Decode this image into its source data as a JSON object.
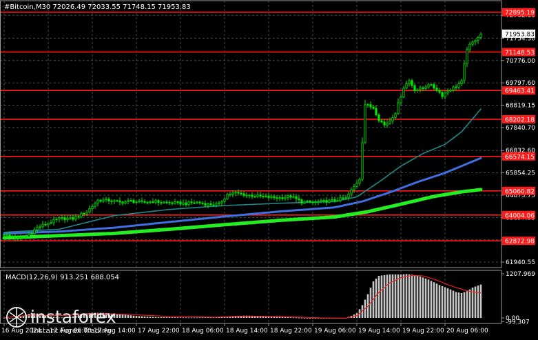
{
  "header": {
    "title": "#Bitcoin,M30  72026.49 72033.55 71748.15 71953.83"
  },
  "macd_header": "MACD(12,26,9) 913.251 688.054",
  "watermark": {
    "brand": "instaforex",
    "tagline": "Instant Forex Trading"
  },
  "colors": {
    "background": "#000000",
    "grid": "#4a4a4a",
    "candle": "#00e800",
    "level_line": "#ff1a1a",
    "ma_fast": "#1e8a8a",
    "ma_mid": "#3f6fe0",
    "ma_slow": "#22ee22",
    "macd_hist": "#c8c8c8",
    "macd_signal": "#ff2020",
    "label_bg": "#ff1a1a",
    "current_price_bg": "#ffffff"
  },
  "chart_data": [
    {
      "type": "candlestick",
      "symbol": "#Bitcoin",
      "timeframe": "M30",
      "ohlc_last": {
        "open": 72026.49,
        "high": 72033.55,
        "low": 71748.15,
        "close": 71953.83
      },
      "current_price": "71953.83",
      "ylim": [
        61700,
        73400
      ],
      "y_ticks": [
        "72762.60",
        "71754.30",
        "70776.00",
        "69797.60",
        "68819.15",
        "67840.70",
        "66832.60",
        "65854.25",
        "64875.75",
        "63897.35",
        "62919.00",
        "61940.55"
      ],
      "x_ticks": [
        "16 Aug 2024",
        "17 Aug 06:00",
        "17 Aug 14:00",
        "17 Aug 22:00",
        "18 Aug 06:00",
        "18 Aug 14:00",
        "18 Aug 22:00",
        "19 Aug 06:00",
        "19 Aug 14:00",
        "19 Aug 22:00",
        "20 Aug 06:00"
      ],
      "x_tick_bars": [
        0,
        16,
        32,
        48,
        64,
        80,
        96,
        112,
        128,
        144,
        160
      ],
      "levels": [
        {
          "label": "72895.19",
          "value": 72895.19
        },
        {
          "label": "71148.53",
          "value": 71148.53
        },
        {
          "label": "69463.41",
          "value": 69463.41
        },
        {
          "label": "68202.18",
          "value": 68202.18
        },
        {
          "label": "66574.15",
          "value": 66574.15
        },
        {
          "label": "65060.82",
          "value": 65060.82
        },
        {
          "label": "64004.06",
          "value": 64004.06
        },
        {
          "label": "62872.98",
          "value": 62872.98
        }
      ],
      "close_anchors": [
        [
          0,
          63150
        ],
        [
          5,
          62980
        ],
        [
          8,
          63050
        ],
        [
          12,
          63450
        ],
        [
          16,
          63650
        ],
        [
          20,
          63850
        ],
        [
          25,
          63850
        ],
        [
          30,
          64150
        ],
        [
          34,
          64650
        ],
        [
          38,
          64650
        ],
        [
          42,
          64560
        ],
        [
          46,
          64620
        ],
        [
          50,
          64550
        ],
        [
          54,
          64600
        ],
        [
          58,
          64560
        ],
        [
          62,
          64530
        ],
        [
          66,
          64510
        ],
        [
          70,
          64560
        ],
        [
          74,
          64470
        ],
        [
          78,
          64480
        ],
        [
          81,
          64900
        ],
        [
          84,
          64970
        ],
        [
          88,
          64880
        ],
        [
          92,
          64830
        ],
        [
          96,
          64780
        ],
        [
          100,
          64760
        ],
        [
          104,
          64820
        ],
        [
          108,
          64580
        ],
        [
          112,
          64560
        ],
        [
          116,
          64600
        ],
        [
          120,
          64650
        ],
        [
          124,
          64750
        ],
        [
          127,
          65250
        ],
        [
          129,
          65600
        ],
        [
          131,
          68850
        ],
        [
          134,
          68700
        ],
        [
          136,
          68200
        ],
        [
          138,
          67950
        ],
        [
          140,
          68150
        ],
        [
          142,
          68500
        ],
        [
          145,
          69600
        ],
        [
          147,
          69900
        ],
        [
          149,
          69500
        ],
        [
          152,
          69550
        ],
        [
          154,
          69750
        ],
        [
          157,
          69500
        ],
        [
          159,
          69250
        ],
        [
          161,
          69450
        ],
        [
          164,
          69650
        ],
        [
          166,
          69850
        ],
        [
          168,
          71300
        ],
        [
          171,
          71700
        ],
        [
          173,
          71950
        ]
      ],
      "series": [
        {
          "name": "",
          "kind": "ma",
          "role": "fast",
          "points": [
            [
              0,
              63250
            ],
            [
              20,
              63380
            ],
            [
              40,
              63980
            ],
            [
              60,
              64250
            ],
            [
              80,
              64420
            ],
            [
              100,
              64520
            ],
            [
              120,
              64600
            ],
            [
              128,
              64800
            ],
            [
              136,
              65450
            ],
            [
              144,
              66150
            ],
            [
              152,
              66700
            ],
            [
              160,
              67100
            ],
            [
              166,
              67650
            ],
            [
              173,
              68650
            ]
          ]
        },
        {
          "name": "",
          "kind": "ma",
          "role": "mid",
          "points": [
            [
              0,
              63200
            ],
            [
              20,
              63280
            ],
            [
              40,
              63450
            ],
            [
              60,
              63700
            ],
            [
              80,
              63940
            ],
            [
              100,
              64160
            ],
            [
              120,
              64340
            ],
            [
              130,
              64600
            ],
            [
              140,
              65000
            ],
            [
              150,
              65450
            ],
            [
              160,
              65850
            ],
            [
              173,
              66500
            ]
          ]
        },
        {
          "name": "",
          "kind": "ma",
          "role": "slow",
          "points": [
            [
              0,
              63000
            ],
            [
              20,
              63100
            ],
            [
              40,
              63200
            ],
            [
              60,
              63380
            ],
            [
              80,
              63580
            ],
            [
              100,
              63770
            ],
            [
              120,
              63920
            ],
            [
              132,
              64150
            ],
            [
              144,
              64480
            ],
            [
              156,
              64820
            ],
            [
              166,
              65020
            ],
            [
              173,
              65120
            ]
          ]
        }
      ]
    },
    {
      "type": "bar",
      "indicator": "MACD(12,26,9)",
      "values_header": "913.251 688.054",
      "y_ticks": [
        "1207.969",
        "0.00",
        "-99.307"
      ],
      "ylim": [
        -150,
        1300
      ],
      "hist_anchors": [
        [
          0,
          0
        ],
        [
          4,
          0
        ],
        [
          6,
          40
        ],
        [
          10,
          140
        ],
        [
          14,
          90
        ],
        [
          18,
          30
        ],
        [
          20,
          10
        ],
        [
          24,
          20
        ],
        [
          28,
          110
        ],
        [
          32,
          140
        ],
        [
          36,
          140
        ],
        [
          40,
          115
        ],
        [
          44,
          85
        ],
        [
          48,
          55
        ],
        [
          52,
          35
        ],
        [
          56,
          20
        ],
        [
          60,
          20
        ],
        [
          64,
          15
        ],
        [
          68,
          10
        ],
        [
          72,
          15
        ],
        [
          76,
          20
        ],
        [
          80,
          35
        ],
        [
          84,
          55
        ],
        [
          88,
          65
        ],
        [
          92,
          55
        ],
        [
          96,
          45
        ],
        [
          100,
          35
        ],
        [
          104,
          15
        ],
        [
          108,
          5
        ],
        [
          112,
          -5
        ],
        [
          116,
          -15
        ],
        [
          120,
          -10
        ],
        [
          124,
          0
        ],
        [
          126,
          60
        ],
        [
          128,
          130
        ],
        [
          130,
          350
        ],
        [
          132,
          650
        ],
        [
          134,
          1000
        ],
        [
          136,
          1150
        ],
        [
          140,
          1190
        ],
        [
          144,
          1190
        ],
        [
          146,
          1200
        ],
        [
          150,
          1160
        ],
        [
          154,
          1050
        ],
        [
          158,
          900
        ],
        [
          162,
          780
        ],
        [
          164,
          710
        ],
        [
          166,
          680
        ],
        [
          168,
          730
        ],
        [
          170,
          830
        ],
        [
          173,
          913
        ]
      ],
      "signal_anchors": [
        [
          0,
          5
        ],
        [
          10,
          80
        ],
        [
          20,
          60
        ],
        [
          32,
          115
        ],
        [
          44,
          100
        ],
        [
          60,
          40
        ],
        [
          76,
          20
        ],
        [
          90,
          50
        ],
        [
          104,
          30
        ],
        [
          116,
          0
        ],
        [
          124,
          -5
        ],
        [
          128,
          60
        ],
        [
          132,
          320
        ],
        [
          136,
          700
        ],
        [
          140,
          960
        ],
        [
          144,
          1100
        ],
        [
          148,
          1160
        ],
        [
          152,
          1150
        ],
        [
          156,
          1060
        ],
        [
          160,
          940
        ],
        [
          164,
          830
        ],
        [
          168,
          740
        ],
        [
          171,
          700
        ],
        [
          173,
          688
        ]
      ]
    }
  ]
}
